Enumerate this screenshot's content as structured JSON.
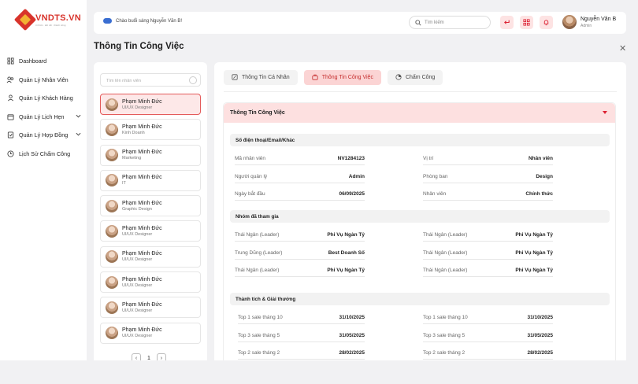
{
  "brand": {
    "name": "VNDTS.VN",
    "tagline": "tri thức · kết nối · thành công"
  },
  "sidebar": {
    "items": [
      {
        "label": "Dashboard",
        "icon": "grid-icon",
        "expandable": false
      },
      {
        "label": "Quản Lý Nhân Viên",
        "icon": "users-icon",
        "expandable": false
      },
      {
        "label": "Quản Lý Khách Hàng",
        "icon": "user-icon",
        "expandable": false
      },
      {
        "label": "Quản Lý Lịch Hẹn",
        "icon": "calendar-icon",
        "expandable": true
      },
      {
        "label": "Quản Lý Hợp Đồng",
        "icon": "contract-icon",
        "expandable": true
      },
      {
        "label": "Lịch Sử Chấm Công",
        "icon": "history-icon",
        "expandable": false
      }
    ]
  },
  "topbar": {
    "greeting": "Chào buổi sáng Nguyễn Văn B!",
    "search_placeholder": "Tìm kiếm",
    "user_name": "Nguyễn Văn B",
    "user_role": "Admin"
  },
  "page": {
    "title": "Thông Tin Công Việc"
  },
  "employee_panel": {
    "search_placeholder": "Tìm tên nhân viên",
    "employees": [
      {
        "name": "Phạm Minh Đức",
        "role": "UI/UX Designer",
        "active": true
      },
      {
        "name": "Phạm Minh Đức",
        "role": "Kinh Doanh",
        "active": false
      },
      {
        "name": "Phạm Minh Đức",
        "role": "Marketing",
        "active": false
      },
      {
        "name": "Phạm Minh Đức",
        "role": "IT",
        "active": false
      },
      {
        "name": "Phạm Minh Đức",
        "role": "Graphic Design",
        "active": false
      },
      {
        "name": "Phạm Minh Đức",
        "role": "UI/UX Designer",
        "active": false
      },
      {
        "name": "Phạm Minh Đức",
        "role": "UI/UX Designer",
        "active": false
      },
      {
        "name": "Phạm Minh Đức",
        "role": "UI/UX Designer",
        "active": false
      },
      {
        "name": "Phạm Minh Đức",
        "role": "UI/UX Designer",
        "active": false
      },
      {
        "name": "Phạm Minh Đức",
        "role": "UI/UX Designer",
        "active": false
      }
    ],
    "page": "1"
  },
  "tabs": [
    {
      "label": "Thông Tin Cá Nhân",
      "icon": "edit-icon",
      "active": false
    },
    {
      "label": "Thông Tin Công Việc",
      "icon": "briefcase-icon",
      "active": true
    },
    {
      "label": "Chấm Công",
      "icon": "pie-icon",
      "active": false
    }
  ],
  "section": {
    "title": "Thông Tin Công Việc",
    "groups": [
      {
        "title": "Số điện thoại/Email/Khác",
        "rows": [
          [
            {
              "k": "Mã nhân viên",
              "v": "NV1284123"
            },
            {
              "k": "Vị trí",
              "v": "Nhân viên"
            }
          ],
          [
            {
              "k": "Người quản lý",
              "v": "Admin"
            },
            {
              "k": "Phòng ban",
              "v": "Design"
            }
          ],
          [
            {
              "k": "Ngày bắt đầu",
              "v": "06/09/2025"
            },
            {
              "k": "Nhân viên",
              "v": "Chính thức"
            }
          ]
        ]
      },
      {
        "title": "Nhóm đã tham gia",
        "rows": [
          [
            {
              "k": "Thái Ngân (Leader)",
              "v": "Phi Vụ Ngàn Tỷ"
            },
            {
              "k": "Thái Ngân (Leader)",
              "v": "Phi Vụ Ngàn Tỷ"
            }
          ],
          [
            {
              "k": "Trung Dũng (Leader)",
              "v": "Best Doanh Số"
            },
            {
              "k": "Thái Ngân (Leader)",
              "v": "Phi Vụ Ngàn Tỷ"
            }
          ],
          [
            {
              "k": "Thái Ngân (Leader)",
              "v": "Phi Vụ Ngàn Tỷ"
            },
            {
              "k": "Thái Ngân (Leader)",
              "v": "Phi Vụ Ngàn Tỷ"
            }
          ]
        ]
      },
      {
        "title": "Thành tích & Giải thưởng",
        "rows": [
          [
            {
              "k": "Top 1 sale tháng 10",
              "v": "31/10/2025"
            },
            {
              "k": "Top 1 sale tháng 10",
              "v": "31/10/2025"
            }
          ],
          [
            {
              "k": "Top 3 sale tháng 5",
              "v": "31/05/2025"
            },
            {
              "k": "Top 3 sale tháng 5",
              "v": "31/05/2025"
            }
          ],
          [
            {
              "k": "Top 2 sale tháng 2",
              "v": "28/02/2025"
            },
            {
              "k": "Top 2 sale tháng 2",
              "v": "28/02/2025"
            }
          ]
        ]
      }
    ]
  },
  "colors": {
    "accent": "#d8332b",
    "accent_soft": "#fde0e0"
  }
}
